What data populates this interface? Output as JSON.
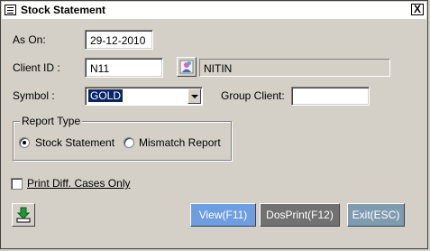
{
  "window": {
    "title": "Stock Statement",
    "close_label": "X"
  },
  "form": {
    "as_on_label": "As On:",
    "as_on_value": "29-12-2010",
    "client_id_label": "Client ID :",
    "client_id_value": "N11",
    "client_name": "NITIN",
    "symbol_label": "Symbol :",
    "symbol_value": "GOLD",
    "group_client_label": "Group Client:",
    "group_client_value": ""
  },
  "report_type": {
    "legend": "Report Type",
    "options": [
      {
        "label": "Stock Statement",
        "selected": true
      },
      {
        "label": "Mismatch Report",
        "selected": false
      }
    ]
  },
  "print_diff": {
    "label": "Print Diff. Cases Only",
    "checked": false
  },
  "buttons": {
    "view": "View(F11)",
    "dosprint": "DosPrint(F12)",
    "exit": "Exit(ESC)"
  },
  "colors": {
    "view_button": "#6e9ee0",
    "dosprint_button": "#717171",
    "exit_button": "#7f9bb0",
    "selection": "#0a246a"
  },
  "icons": {
    "client_lookup": "person-lookup-icon",
    "export": "download-icon",
    "system_menu": "window-menu-icon"
  }
}
